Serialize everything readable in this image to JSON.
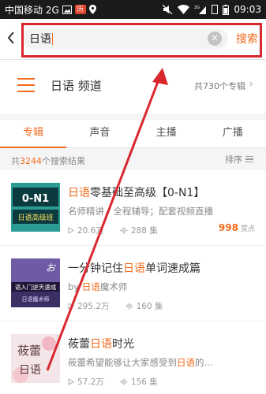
{
  "status": {
    "carrier": "中国移动 2G",
    "time": "09:03",
    "network": "2G"
  },
  "search": {
    "query": "日语",
    "submit_label": "搜索",
    "clear_glyph": "✕"
  },
  "channel": {
    "title": "日语 频道",
    "count_text": "共730个专辑",
    "arrow": "›"
  },
  "tabs": [
    {
      "label": "专辑",
      "active": true
    },
    {
      "label": "声音",
      "active": false
    },
    {
      "label": "主播",
      "active": false
    },
    {
      "label": "广播",
      "active": false
    }
  ],
  "results": {
    "prefix": "共",
    "count": "3244",
    "suffix": "个搜索结果",
    "sort_label": "排序"
  },
  "items": [
    {
      "title_hl": "日语",
      "title_rest": "零基础至高级【0-N1】",
      "desc": "名师精讲，全程辅导；配套视频直播",
      "plays": "20.6万",
      "episodes": "288 集",
      "score": "998",
      "score_label": "赏点",
      "thumb_lines": [
        "0-N1",
        "日语高级班"
      ]
    },
    {
      "title_pre": "一分钟记住",
      "title_hl": "日语",
      "title_rest": "单词速成篇",
      "desc_pre": "by ",
      "desc_hl": "日语",
      "desc_rest": "魔术师",
      "plays": "295.2万",
      "episodes": "160 集",
      "thumb_lines": [
        "语入门逆天速成",
        "日语魔术师"
      ]
    },
    {
      "title_pre": "莜蕾",
      "title_hl": "日语",
      "title_rest": "时光",
      "desc_pre": "莜蕾希望能够让大家感受到",
      "desc_hl": "日语",
      "desc_rest": "的...",
      "plays": "57.2万",
      "episodes": "156 集",
      "thumb_lines": [
        "莜蕾",
        "日语"
      ]
    }
  ],
  "colors": {
    "accent": "#f26b1d",
    "annotation": "#d9272e"
  }
}
